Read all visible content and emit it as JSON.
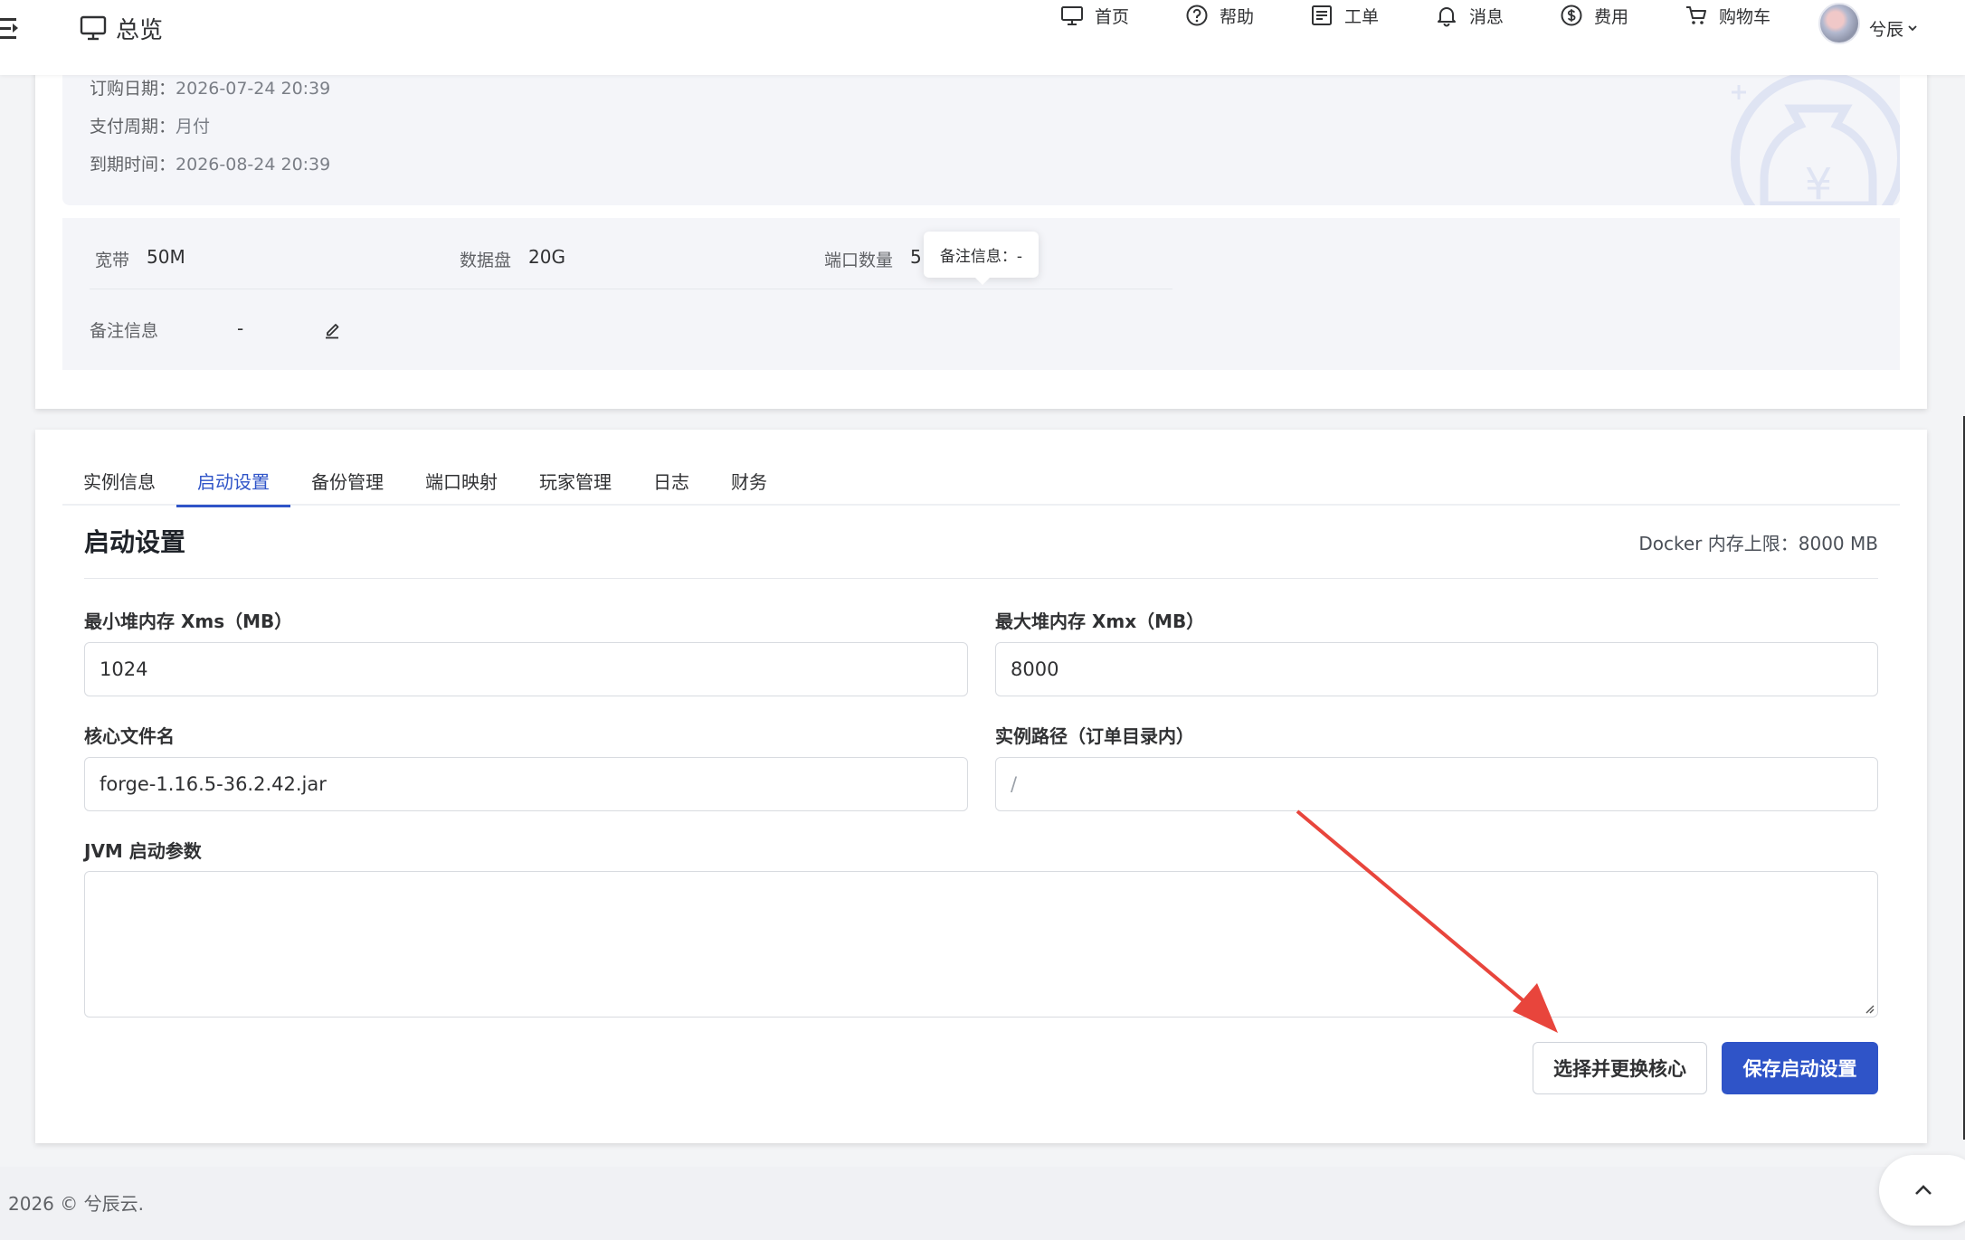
{
  "header": {
    "brand": "总览",
    "nav": [
      {
        "label": "首页",
        "icon": "monitor-icon"
      },
      {
        "label": "帮助",
        "icon": "help-circle-icon"
      },
      {
        "label": "工单",
        "icon": "ticket-icon"
      },
      {
        "label": "消息",
        "icon": "bell-icon"
      },
      {
        "label": "费用",
        "icon": "dollar-icon"
      },
      {
        "label": "购物车",
        "icon": "cart-icon"
      }
    ],
    "user": "兮辰"
  },
  "order": {
    "purchase_date_label": "订购日期：",
    "purchase_date": "2026-07-24 20:39",
    "cycle_label": "支付周期：",
    "cycle": "月付",
    "expire_label": "到期时间：",
    "expire": "2026-08-24 20:39"
  },
  "specs": {
    "bandwidth_label": "宽带",
    "bandwidth": "50M",
    "disk_label": "数据盘",
    "disk": "20G",
    "ports_label": "端口数量",
    "ports_partial": "5",
    "remark_label": "备注信息",
    "remark": "-"
  },
  "tooltip": "备注信息：-",
  "tabs": [
    "实例信息",
    "启动设置",
    "备份管理",
    "端口映射",
    "玩家管理",
    "日志",
    "财务"
  ],
  "active_tab": "启动设置",
  "startup": {
    "title": "启动设置",
    "docker_limit": "Docker 内存上限：8000 MB",
    "xms_label": "最小堆内存 Xms（MB）",
    "xms_value": "1024",
    "xmx_label": "最大堆内存 Xmx（MB）",
    "xmx_value": "8000",
    "core_label": "核心文件名",
    "core_value": "forge-1.16.5-36.2.42.jar",
    "path_label": "实例路径（订单目录内）",
    "path_placeholder": "/",
    "jvm_label": "JVM 启动参数",
    "jvm_value": "",
    "change_core_button": "选择并更换核心",
    "save_button": "保存启动设置"
  },
  "footer": {
    "copyright": "2026 © 兮辰云."
  },
  "colors": {
    "primary": "#2f54c8",
    "annotation_arrow": "#e8453c"
  }
}
